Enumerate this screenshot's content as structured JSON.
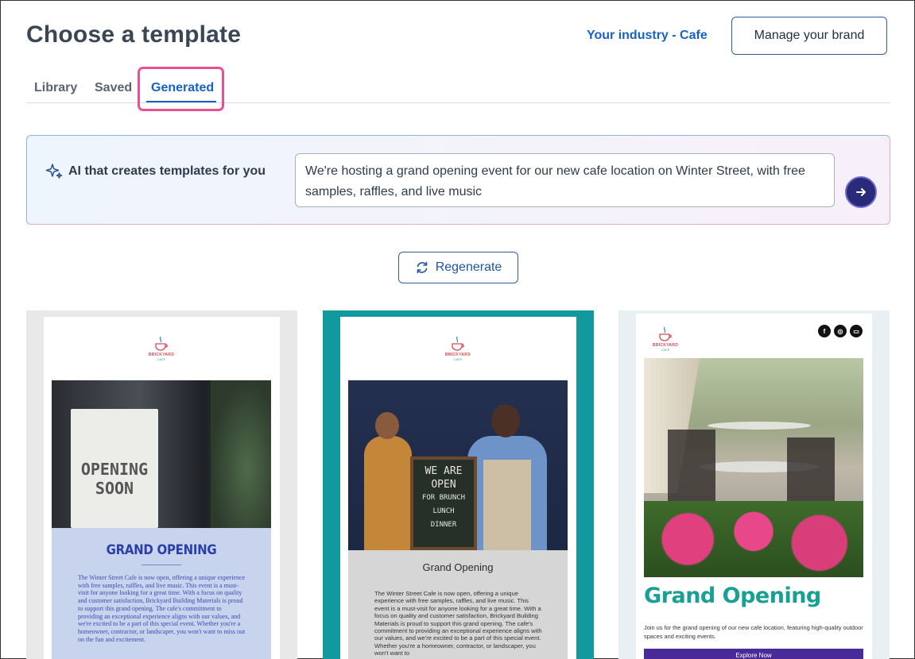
{
  "header": {
    "title": "Choose a template",
    "industry_link": "Your industry - Cafe",
    "manage_brand_label": "Manage your brand"
  },
  "tabs": [
    {
      "label": "Library",
      "active": false
    },
    {
      "label": "Saved",
      "active": false
    },
    {
      "label": "Generated",
      "active": true
    }
  ],
  "ai_panel": {
    "label": "AI that creates templates for you",
    "prompt_value": "We're hosting a grand opening event for our new cafe location on Winter Street, with free samples, raffles, and live music",
    "submit_icon": "arrow-right-icon",
    "icon": "sparkle-icon"
  },
  "regenerate": {
    "label": "Regenerate",
    "icon": "refresh-icon"
  },
  "templates": [
    {
      "logo_text": "BRICKYARD",
      "logo_sub": "CAFE",
      "sign_line1": "OPENING",
      "sign_line2": "SOON",
      "title": "GRAND OPENING",
      "body": "The Winter Street Cafe is now open, offering a unique experience with free samples, raffles, and live music. This event is a must-visit for anyone looking for a great time. With a focus on quality and customer satisfaction, Brickyard Building Materials is proud to support this grand opening. The cafe's commitment to providing an exceptional experience aligns with our values, and we're excited to be a part of this special event. Whether you're a homeowner, contractor, or landscaper, you won't want to miss out on the fun and excitement."
    },
    {
      "logo_text": "BRICKYARD",
      "logo_sub": "CAFE",
      "chalk_line1": "WE ARE",
      "chalk_line2": "OPEN",
      "chalk_line3": "FOR BRUNCH",
      "chalk_line4": "LUNCH",
      "chalk_line5": "DINNER",
      "title": "Grand Opening",
      "body": "The Winter Street Cafe is now open, offering a unique experience with free samples, raffles, and live music. This event is a must-visit for anyone looking for a great time. With a focus on quality and customer satisfaction, Brickyard Building Materials is proud to support this grand opening. The cafe's commitment to providing an exceptional experience aligns with our values, and we're excited to be a part of this special event. Whether you're a homeowner, contractor, or landscaper, you won't want to"
    },
    {
      "logo_text": "BRICKYARD",
      "logo_sub": "CAFE",
      "social_icons": [
        "facebook-icon",
        "instagram-icon",
        "website-icon"
      ],
      "title": "Grand Opening",
      "body": "Join us for the grand opening of our new cafe location, featuring high-quality outdoor spaces and exciting events.",
      "button_label": "Explore Now"
    }
  ],
  "colors": {
    "accent": "#1762c5",
    "highlight": "#ea4f95",
    "submit": "#2a2a78",
    "card2_frame": "#12999e",
    "card3_title": "#19a094"
  }
}
